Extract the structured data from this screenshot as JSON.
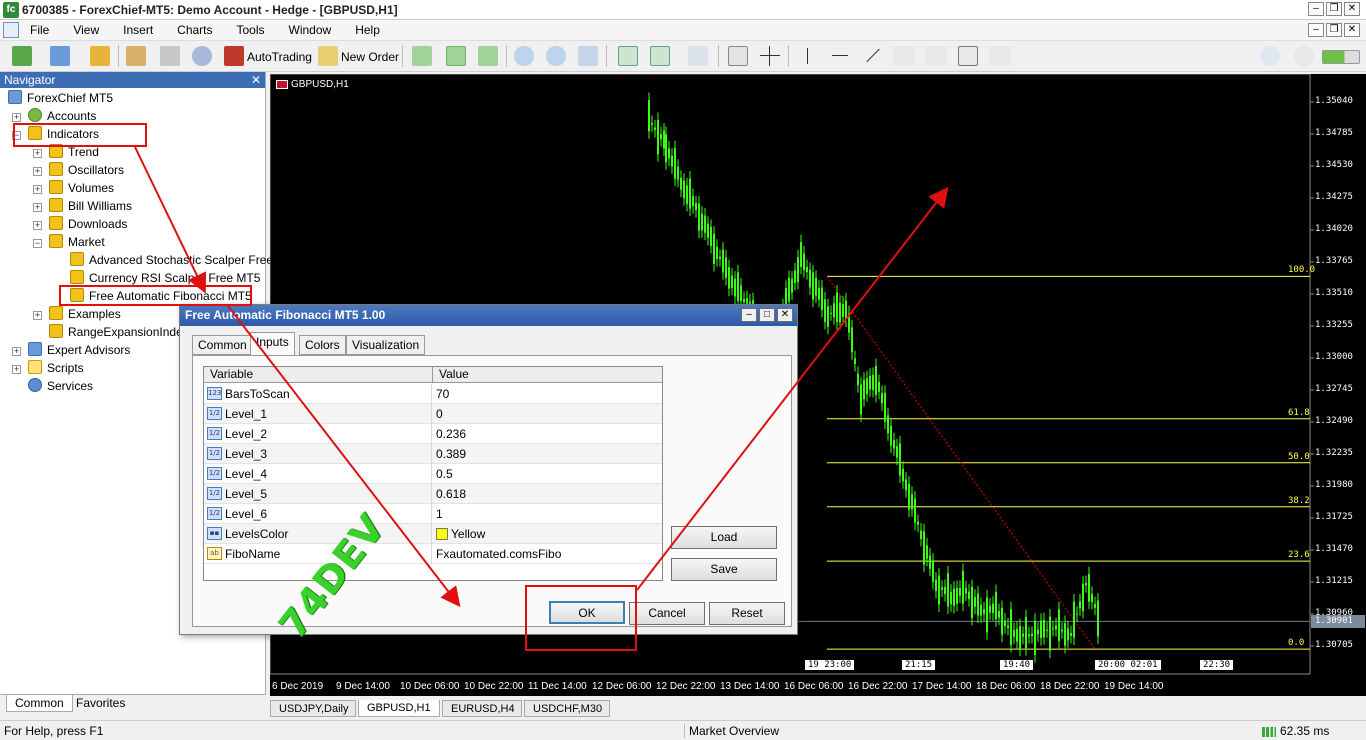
{
  "window": {
    "title": "6700385 - ForexChief-MT5: Demo Account - Hedge - [GBPUSD,H1]"
  },
  "menu": [
    "File",
    "Insert",
    "Charts",
    "Tools",
    "Window",
    "Help"
  ],
  "toolbar": {
    "autotrading": "AutoTrading",
    "new_order": "New Order"
  },
  "navigator": {
    "title": "Navigator",
    "root": "ForexChief MT5",
    "items": [
      {
        "label": "Accounts",
        "icon": "accounts-icon"
      },
      {
        "label": "Indicators",
        "icon": "indicator-folder-icon"
      },
      {
        "label": "Trend",
        "icon": "indicator-folder-icon"
      },
      {
        "label": "Oscillators",
        "icon": "indicator-folder-icon"
      },
      {
        "label": "Volumes",
        "icon": "indicator-folder-icon"
      },
      {
        "label": "Bill Williams",
        "icon": "indicator-folder-icon"
      },
      {
        "label": "Downloads",
        "icon": "indicator-folder-icon"
      },
      {
        "label": "Market",
        "icon": "market-icon"
      },
      {
        "label": "Advanced Stochastic Scalper Free f",
        "icon": "indicator-icon"
      },
      {
        "label": "Currency RSI Scalper Free MT5",
        "icon": "indicator-icon"
      },
      {
        "label": "Free Automatic Fibonacci MT5",
        "icon": "indicator-icon"
      },
      {
        "label": "Examples",
        "icon": "indicator-folder-icon"
      },
      {
        "label": "RangeExpansionIndex",
        "icon": "indicator-icon"
      },
      {
        "label": "Expert Advisors",
        "icon": "expert-icon"
      },
      {
        "label": "Scripts",
        "icon": "script-icon"
      },
      {
        "label": "Services",
        "icon": "gear-icon"
      }
    ],
    "tabs": [
      "Common",
      "Favorites"
    ]
  },
  "chart": {
    "symbol_label": "GBPUSD,H1",
    "prices": [
      "1.35040",
      "1.34785",
      "1.34530",
      "1.34275",
      "1.34020",
      "1.33765",
      "1.33510",
      "1.33255",
      "1.33000",
      "1.32745",
      "1.32490",
      "1.32235",
      "1.31980",
      "1.31725",
      "1.31470",
      "1.31215",
      "1.30960",
      "1.30705"
    ],
    "current_price": "1.30901",
    "fib_levels": [
      "100.0",
      "61.8",
      "50.0",
      "38.2",
      "23.6",
      "0.0"
    ],
    "times": [
      "6 Dec 2019",
      "9 Dec 14:00",
      "10 Dec 06:00",
      "10 Dec 22:00",
      "11 Dec 14:00",
      "12 Dec 06:00",
      "12 Dec 22:00",
      "13 Dec 14:00",
      "16 Dec 06:00",
      "16 Dec 22:00",
      "17 Dec 14:00",
      "18 Dec 06:00",
      "18 Dec 22:00",
      "19 Dec 14:00"
    ],
    "time_markers": [
      "19 23:00",
      "21:15",
      "19:40",
      "20:00 02:01",
      "22:30"
    ]
  },
  "chart_tabs": [
    "USDJPY,Daily",
    "GBPUSD,H1",
    "EURUSD,H4",
    "USDCHF,M30"
  ],
  "dialog": {
    "title": "Free Automatic Fibonacci MT5 1.00",
    "tabs": [
      "Common",
      "Inputs",
      "Colors",
      "Visualization"
    ],
    "columns": [
      "Variable",
      "Value"
    ],
    "params": [
      {
        "icon": "123",
        "name": "BarsToScan",
        "value": "70"
      },
      {
        "icon": "1/2",
        "name": "Level_1",
        "value": "0"
      },
      {
        "icon": "1/2",
        "name": "Level_2",
        "value": "0.236"
      },
      {
        "icon": "1/2",
        "name": "Level_3",
        "value": "0.389"
      },
      {
        "icon": "1/2",
        "name": "Level_4",
        "value": "0.5"
      },
      {
        "icon": "1/2",
        "name": "Level_5",
        "value": "0.618"
      },
      {
        "icon": "1/2",
        "name": "Level_6",
        "value": "1"
      },
      {
        "icon": "▪▪",
        "name": "LevelsColor",
        "value": "Yellow"
      },
      {
        "icon": "ab",
        "name": "FiboName",
        "value": "Fxautomated.comsFibo"
      }
    ],
    "buttons": {
      "load": "Load",
      "save": "Save",
      "ok": "OK",
      "cancel": "Cancel",
      "reset": "Reset"
    }
  },
  "status": {
    "help": "For Help, press F1",
    "overview": "Market Overview",
    "ping": "62.35 ms"
  },
  "watermark": "74DEV",
  "colors": {
    "accent": "#3c6db5",
    "candle": "#39ff14",
    "fib": "#ffff44",
    "annotation": "#e01010"
  }
}
